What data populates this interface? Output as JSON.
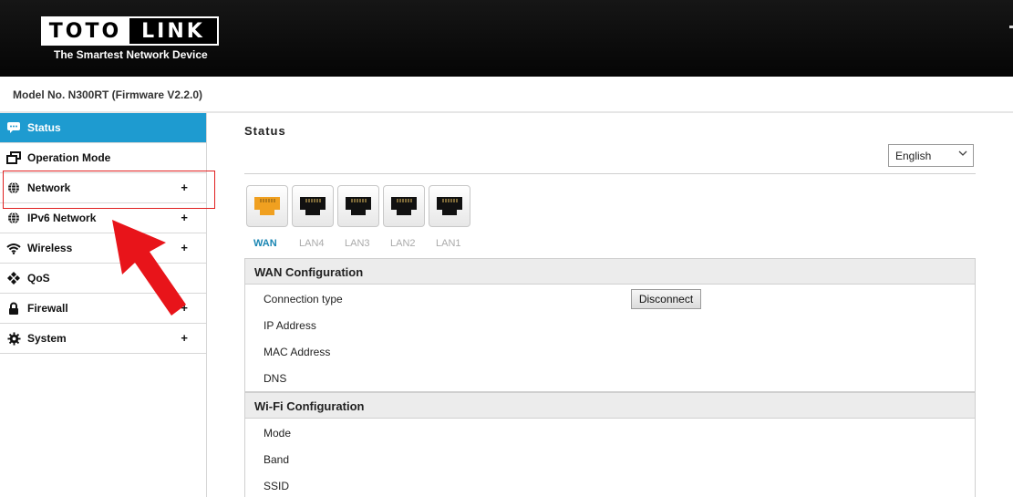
{
  "brand": {
    "logo_left": "TOTO",
    "logo_right": "LINK",
    "tagline": "The Smartest Network Device"
  },
  "model_info": "Model No. N300RT (Firmware V2.2.0)",
  "sidebar": {
    "items": [
      {
        "label": "Status",
        "icon": "chat-icon",
        "active": true
      },
      {
        "label": "Operation Mode",
        "icon": "windows-icon"
      },
      {
        "label": "Network",
        "icon": "globe-icon",
        "expand": "+"
      },
      {
        "label": "IPv6 Network",
        "icon": "globe-icon",
        "expand": "+"
      },
      {
        "label": "Wireless",
        "icon": "wifi-icon",
        "expand": "+"
      },
      {
        "label": "QoS",
        "icon": "qos-icon"
      },
      {
        "label": "Firewall",
        "icon": "lock-icon",
        "expand": "+"
      },
      {
        "label": "System",
        "icon": "gear-icon",
        "expand": "+"
      }
    ]
  },
  "main": {
    "title": "Status",
    "language": {
      "selected": "English"
    },
    "ports": [
      {
        "label": "WAN",
        "active": true,
        "color": "#f0a020"
      },
      {
        "label": "LAN4",
        "color": "#111111"
      },
      {
        "label": "LAN3",
        "color": "#111111"
      },
      {
        "label": "LAN2",
        "color": "#111111"
      },
      {
        "label": "LAN1",
        "color": "#111111"
      }
    ],
    "wan": {
      "title": "WAN Configuration",
      "rows": [
        "Connection type",
        "IP Address",
        "MAC Address",
        "DNS"
      ],
      "disconnect_label": "Disconnect"
    },
    "wifi": {
      "title": "Wi-Fi Configuration",
      "rows": [
        "Mode",
        "Band",
        "SSID"
      ]
    }
  },
  "colors": {
    "accent": "#1e9bd0",
    "highlight": "#e02020",
    "arrow": "#e8141a"
  }
}
